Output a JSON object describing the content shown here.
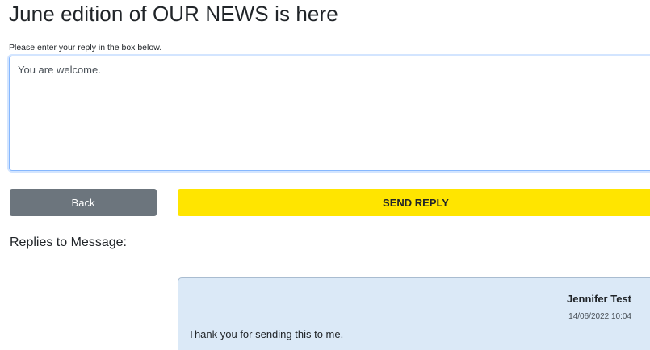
{
  "page": {
    "title": "June edition of OUR NEWS is here",
    "prompt": "Please enter your reply in the box below."
  },
  "reply_form": {
    "value": "You are welcome.",
    "back_label": "Back",
    "send_label": "SEND REPLY"
  },
  "replies": {
    "heading": "Replies to Message:",
    "items": [
      {
        "author": "Jennifer Test",
        "timestamp": "14/06/2022 10:04",
        "text": "Thank you for sending this to me."
      }
    ]
  },
  "colors": {
    "back_button": "#6c757d",
    "send_button": "#ffe500",
    "reply_card_bg": "#dbe9f7",
    "input_focus_border": "#86b7fe"
  }
}
